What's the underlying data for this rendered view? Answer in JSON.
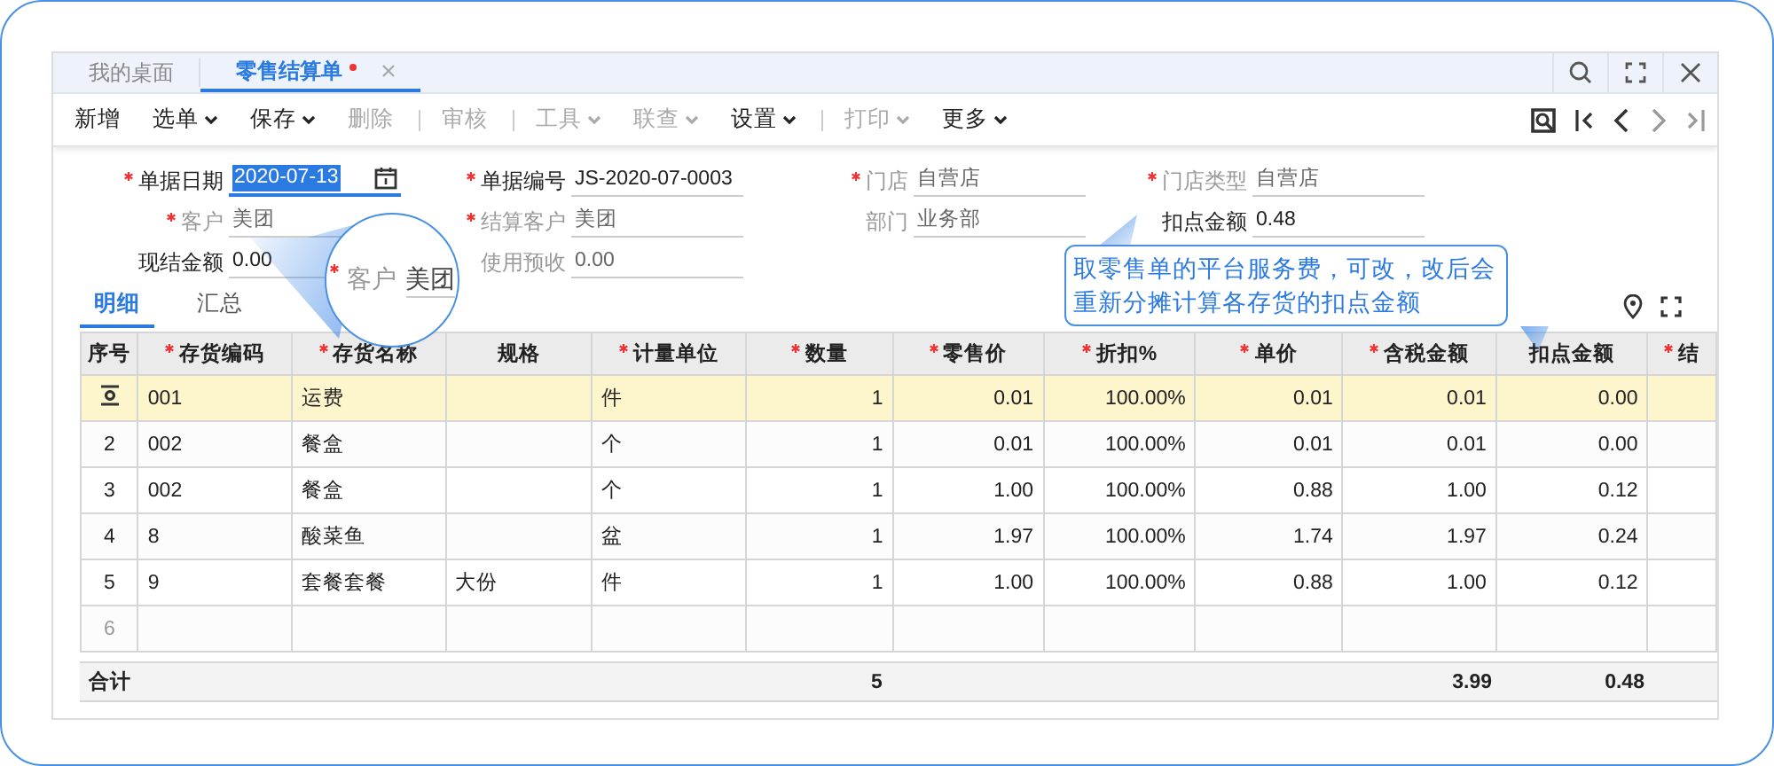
{
  "tabs": [
    {
      "label": "我的桌面",
      "selected": false,
      "modified": false,
      "closable": false
    },
    {
      "label": "零售结算单",
      "selected": true,
      "modified": true,
      "closable": true
    }
  ],
  "toolbar": [
    {
      "label": "新增",
      "dropdown": false,
      "disabled": false,
      "separator_before": false
    },
    {
      "label": "选单",
      "dropdown": true,
      "disabled": false,
      "separator_before": false
    },
    {
      "label": "保存",
      "dropdown": true,
      "disabled": false,
      "separator_before": false
    },
    {
      "label": "删除",
      "dropdown": false,
      "disabled": true,
      "separator_before": false
    },
    {
      "label": "审核",
      "dropdown": false,
      "disabled": true,
      "separator_before": true
    },
    {
      "label": "工具",
      "dropdown": true,
      "disabled": true,
      "separator_before": true
    },
    {
      "label": "联查",
      "dropdown": true,
      "disabled": true,
      "separator_before": false
    },
    {
      "label": "设置",
      "dropdown": true,
      "disabled": false,
      "separator_before": false
    },
    {
      "label": "打印",
      "dropdown": true,
      "disabled": true,
      "separator_before": true
    },
    {
      "label": "更多",
      "dropdown": true,
      "disabled": false,
      "separator_before": false
    }
  ],
  "form": [
    {
      "label": "单据日期",
      "value": "2020-07-13",
      "required": true,
      "disabled": false,
      "kind": "date"
    },
    {
      "label": "单据编号",
      "value": "JS-2020-07-0003",
      "required": true,
      "disabled": false,
      "kind": "text"
    },
    {
      "label": "门店",
      "value": "自营店",
      "required": true,
      "disabled": true,
      "kind": "text"
    },
    {
      "label": "门店类型",
      "value": "自营店",
      "required": true,
      "disabled": true,
      "kind": "text"
    },
    {
      "label": "客户",
      "value": "美团",
      "required": true,
      "disabled": true,
      "kind": "text"
    },
    {
      "label": "结算客户",
      "value": "美团",
      "required": true,
      "disabled": true,
      "kind": "text"
    },
    {
      "label": "部门",
      "value": "业务部",
      "required": false,
      "disabled": true,
      "kind": "text"
    },
    {
      "label": "扣点金额",
      "value": "0.48",
      "required": false,
      "disabled": false,
      "kind": "text"
    },
    {
      "label": "现结金额",
      "value": "0.00",
      "required": false,
      "disabled": false,
      "kind": "text"
    },
    {
      "label": "使用预收",
      "value": "0.00",
      "required": false,
      "disabled": true,
      "kind": "text"
    }
  ],
  "magnifier": {
    "label": "客户",
    "value": "美团",
    "required": true
  },
  "callout": {
    "lines": [
      "取零售单的平台服务费，可改，改后会",
      "重新分摊计算各存货的扣点金额"
    ]
  },
  "subtabs": [
    {
      "label": "明细",
      "selected": true
    },
    {
      "label": "汇总",
      "selected": false
    }
  ],
  "table": {
    "columns": [
      {
        "label": "序号",
        "required": false
      },
      {
        "label": "存货编码",
        "required": true
      },
      {
        "label": "存货名称",
        "required": true
      },
      {
        "label": "规格",
        "required": false
      },
      {
        "label": "计量单位",
        "required": true
      },
      {
        "label": "数量",
        "required": true
      },
      {
        "label": "零售价",
        "required": true
      },
      {
        "label": "折扣%",
        "required": true
      },
      {
        "label": "单价",
        "required": true
      },
      {
        "label": "含税金额",
        "required": true
      },
      {
        "label": "扣点金额",
        "required": false
      },
      {
        "label": "结",
        "required": true
      }
    ],
    "rows": [
      {
        "kind": "item",
        "selected": true,
        "cells": [
          "001",
          "运费",
          null,
          "件",
          "1",
          "0.01",
          "100.00%",
          "0.01",
          "0.01",
          "0.00"
        ]
      },
      {
        "kind": "item",
        "selected": false,
        "no": "2",
        "cells": [
          "002",
          "餐盒",
          null,
          "个",
          "1",
          "0.01",
          "100.00%",
          "0.01",
          "0.01",
          "0.00"
        ]
      },
      {
        "kind": "item",
        "selected": false,
        "no": "3",
        "cells": [
          "002",
          "餐盒",
          null,
          "个",
          "1",
          "1.00",
          "100.00%",
          "0.88",
          "1.00",
          "0.12"
        ]
      },
      {
        "kind": "item",
        "selected": false,
        "no": "4",
        "cells": [
          "8",
          "酸菜鱼",
          null,
          "盆",
          "1",
          "1.97",
          "100.00%",
          "1.74",
          "1.97",
          "0.24"
        ]
      },
      {
        "kind": "item",
        "selected": false,
        "no": "5",
        "cells": [
          "9",
          "套餐套餐",
          "大份",
          "件",
          "1",
          "1.00",
          "100.00%",
          "0.88",
          "1.00",
          "0.12"
        ]
      },
      {
        "kind": "blank",
        "selected": false,
        "no": "6"
      }
    ],
    "totals": {
      "label": "合计",
      "cells": [
        null,
        null,
        null,
        null,
        "5",
        null,
        null,
        null,
        "3.99",
        "0.48"
      ]
    }
  }
}
